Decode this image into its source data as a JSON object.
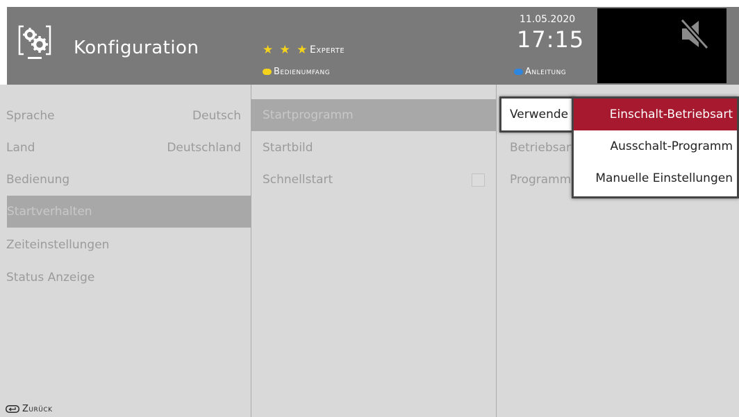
{
  "header": {
    "title": "Konfiguration",
    "icon": "settings-monitor-icon",
    "stars": "★ ★ ★",
    "level": "Experte",
    "scope_hint": "Bedienumfang",
    "help_hint": "Anleitung",
    "date": "11.05.2020",
    "time": "17:15",
    "mute_icon": "muted-speaker-icon"
  },
  "colors": {
    "header_bg": "#7a7a7a",
    "panel_bg": "#d9d9d9",
    "selected_bg": "#a8a8a8",
    "accent_red": "#a6192e",
    "yellow": "#f5d31d",
    "blue": "#2e86de"
  },
  "menu": {
    "items": [
      {
        "label": "Sprache",
        "value": "Deutsch"
      },
      {
        "label": "Land",
        "value": "Deutschland"
      },
      {
        "label": "Bedienung",
        "value": ""
      },
      {
        "label": "Startverhalten",
        "value": ""
      },
      {
        "label": "Zeiteinstellungen",
        "value": ""
      },
      {
        "label": "Status Anzeige",
        "value": ""
      }
    ],
    "selected_index": 3
  },
  "submenu": {
    "items": [
      {
        "label": "Startprogramm"
      },
      {
        "label": "Startbild"
      },
      {
        "label": "Schnellstart",
        "checkbox": false
      }
    ],
    "selected_index": 0
  },
  "options": {
    "items": [
      {
        "label": "Verwende"
      },
      {
        "label": "Betriebsart"
      },
      {
        "label": "Programm"
      }
    ],
    "focused_label": "Verwende"
  },
  "dropdown": {
    "options": [
      "Einschalt-Betriebsart",
      "Ausschalt-Programm",
      "Manuelle Einstellungen"
    ],
    "selected_index": 0
  },
  "footer": {
    "back_label": "Zurück",
    "back_icon": "return-key-icon"
  }
}
